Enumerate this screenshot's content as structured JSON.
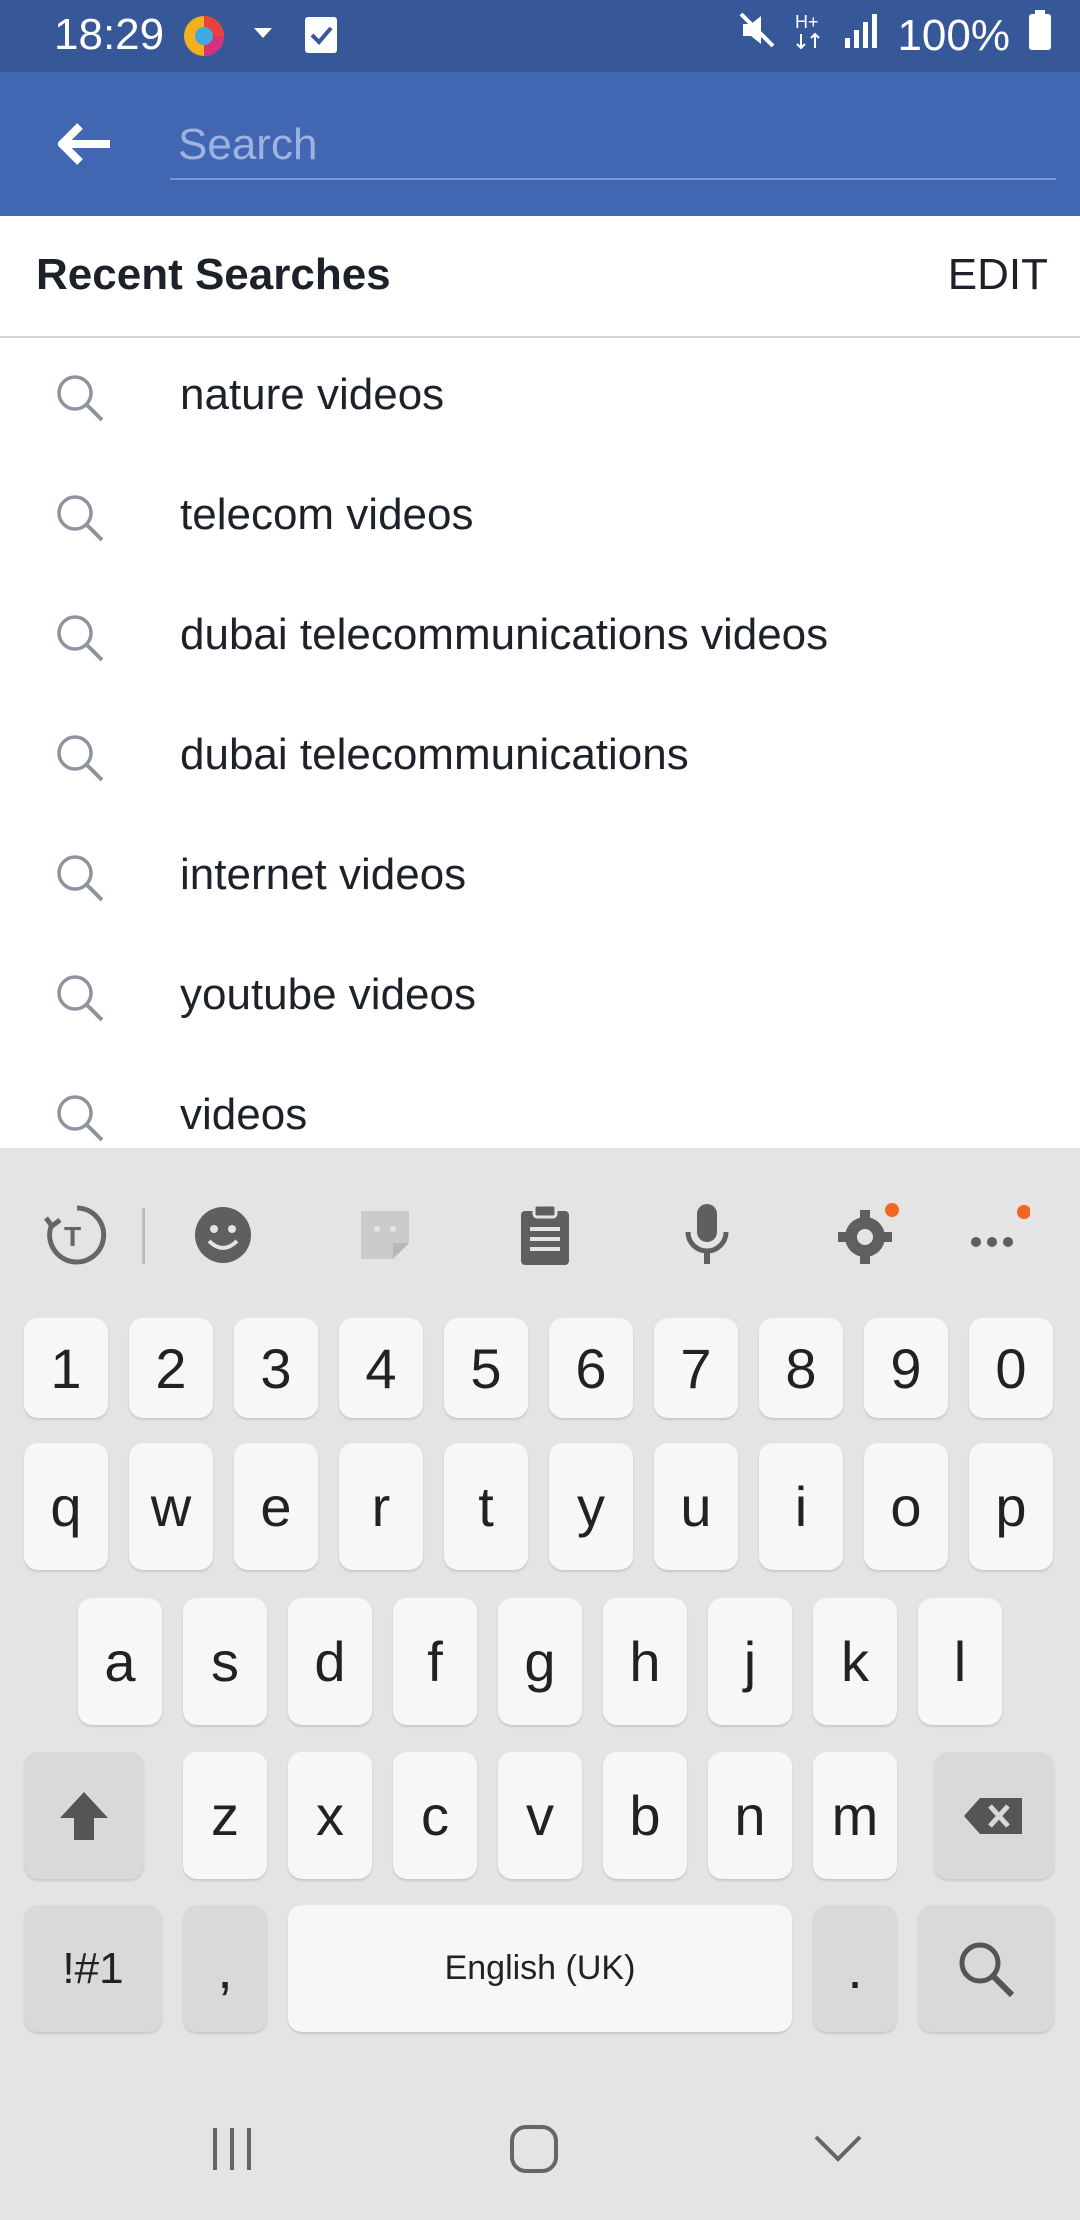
{
  "status_bar": {
    "time": "18:29",
    "battery": "100%",
    "icons": [
      "app-icon",
      "dropdown-icon",
      "checkbox-icon",
      "mute-icon",
      "hplus-icon",
      "signal-icon",
      "battery-icon"
    ]
  },
  "search": {
    "placeholder": "Search",
    "value": ""
  },
  "recent": {
    "title": "Recent Searches",
    "edit_label": "EDIT",
    "items": [
      "nature videos",
      "telecom videos",
      "dubai telecommunications videos",
      "dubai telecommunications",
      "internet videos",
      "youtube videos",
      "videos"
    ]
  },
  "keyboard": {
    "toolbar_icons": [
      "text-mode-icon",
      "emoji-icon",
      "sticker-icon",
      "clipboard-icon",
      "microphone-icon",
      "settings-icon",
      "more-icon"
    ],
    "row_numbers": [
      "1",
      "2",
      "3",
      "4",
      "5",
      "6",
      "7",
      "8",
      "9",
      "0"
    ],
    "row_top": [
      "q",
      "w",
      "e",
      "r",
      "t",
      "y",
      "u",
      "i",
      "o",
      "p"
    ],
    "row_middle": [
      "a",
      "s",
      "d",
      "f",
      "g",
      "h",
      "j",
      "k",
      "l"
    ],
    "row_bottom": [
      "z",
      "x",
      "c",
      "v",
      "b",
      "n",
      "m"
    ],
    "symbols_label": "!#1",
    "comma_label": ",",
    "space_label": "English (UK)",
    "period_label": "."
  },
  "colors": {
    "status_bar": "#365899",
    "header": "#4267b2",
    "accent_dot": "#f26522",
    "keyboard_bg": "#e4e4e4"
  }
}
